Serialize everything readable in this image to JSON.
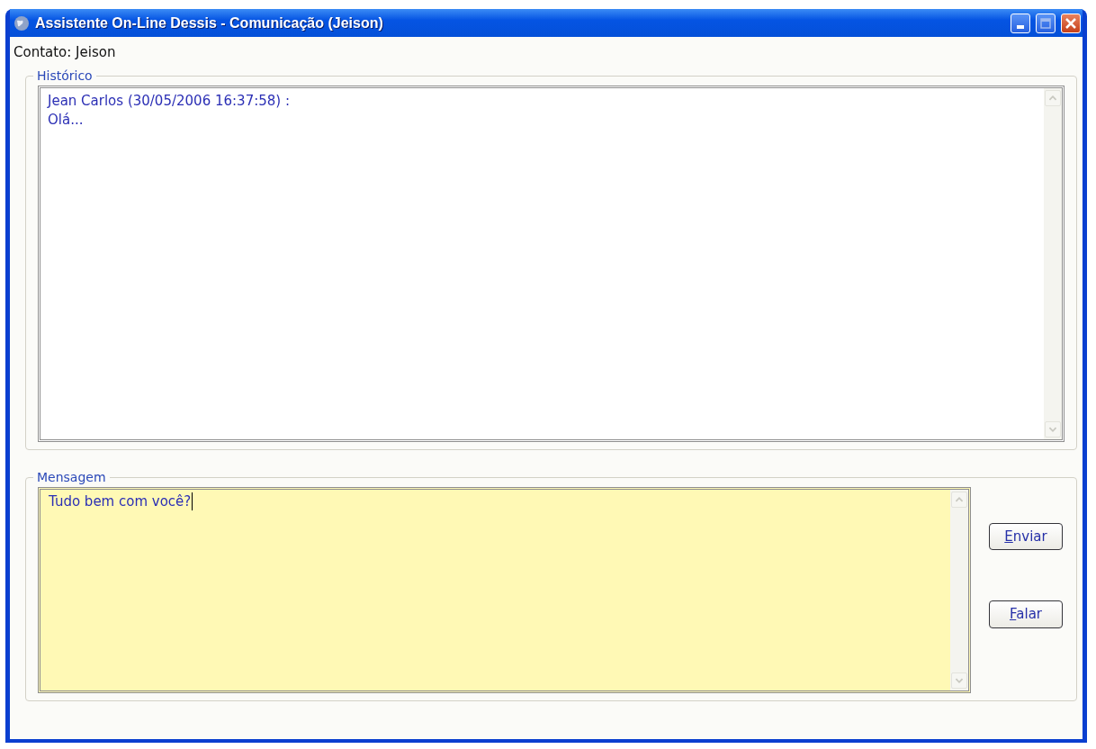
{
  "window": {
    "title": "Assistente On-Line Dessis - Comunicação (Jeison)"
  },
  "contact": "Contato: Jeison",
  "history": {
    "legend": "Histórico",
    "lines": [
      "Jean Carlos (30/05/2006 16:37:58) :",
      "Olá..."
    ]
  },
  "message": {
    "legend": "Mensagem",
    "value": "Tudo bem com você?"
  },
  "buttons": [
    {
      "label": "Enviar",
      "first_letter_underlined": true
    },
    {
      "label": "Falar",
      "first_letter_underlined": true
    }
  ]
}
